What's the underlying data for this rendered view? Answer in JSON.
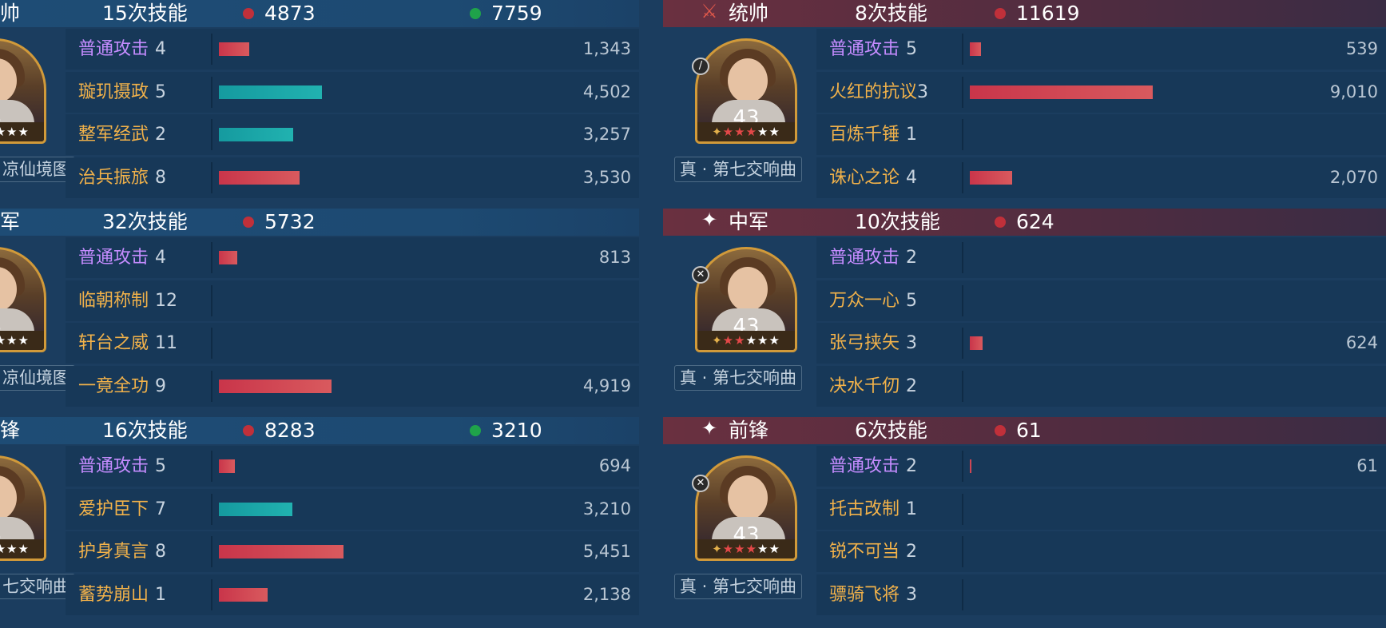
{
  "colors": {
    "red_bar": "#c9354a",
    "teal_bar": "#159a9f",
    "dot_red": "#c0303a",
    "dot_green": "#1fa34a"
  },
  "left": {
    "blocks": [
      {
        "role": "帅",
        "skill_count": "15次技能",
        "damage": "4873",
        "heal": "7759",
        "portrait": {
          "level": "3",
          "stars_on": 0,
          "stars_total": 5
        },
        "tag": "凉仙境图",
        "rows": [
          {
            "skill": "普通攻击",
            "count": "4",
            "bar": "red",
            "value": "1,343",
            "raw": 1343
          },
          {
            "skill": "璇玑摄政",
            "count": "5",
            "bar": "teal",
            "value": "4,502",
            "raw": 4502
          },
          {
            "skill": "整军经武",
            "count": "2",
            "bar": "teal",
            "value": "3,257",
            "raw": 3257
          },
          {
            "skill": "治兵振旅",
            "count": "8",
            "bar": "red",
            "value": "3,530",
            "raw": 3530
          }
        ]
      },
      {
        "role": "军",
        "skill_count": "32次技能",
        "damage": "5732",
        "heal": "",
        "portrait": {
          "level": "3",
          "stars_on": 0,
          "stars_total": 5
        },
        "tag": "凉仙境图",
        "rows": [
          {
            "skill": "普通攻击",
            "count": "4",
            "bar": "red",
            "value": "813",
            "raw": 813
          },
          {
            "skill": "临朝称制",
            "count": "12",
            "bar": "",
            "value": "",
            "raw": 0
          },
          {
            "skill": "轩台之威",
            "count": "11",
            "bar": "",
            "value": "",
            "raw": 0
          },
          {
            "skill": "一竟全功",
            "count": "9",
            "bar": "red",
            "value": "4,919",
            "raw": 4919
          }
        ]
      },
      {
        "role": "锋",
        "skill_count": "16次技能",
        "damage": "8283",
        "heal": "3210",
        "portrait": {
          "level": "3",
          "stars_on": 0,
          "stars_total": 5
        },
        "tag": "七交响曲",
        "rows": [
          {
            "skill": "普通攻击",
            "count": "5",
            "bar": "red",
            "value": "694",
            "raw": 694
          },
          {
            "skill": "爱护臣下",
            "count": "7",
            "bar": "teal",
            "value": "3,210",
            "raw": 3210
          },
          {
            "skill": "护身真言",
            "count": "8",
            "bar": "red",
            "value": "5,451",
            "raw": 5451
          },
          {
            "skill": "蓄势崩山",
            "count": "1",
            "bar": "red",
            "value": "2,138",
            "raw": 2138
          }
        ]
      }
    ]
  },
  "right": {
    "blocks": [
      {
        "role": "统帅",
        "role_icon": "sword-flag-icon",
        "skill_count": "8次技能",
        "damage": "11619",
        "heal": "",
        "portrait": {
          "level": "43",
          "stars_on": 3,
          "stars_total": 5
        },
        "badge": "/",
        "tag": "真 · 第七交响曲",
        "rows": [
          {
            "skill": "普通攻击",
            "count": "5",
            "bar": "red",
            "value": "539",
            "raw": 539
          },
          {
            "skill": "火红的抗议",
            "count": "3",
            "bar": "red",
            "value": "9,010",
            "raw": 9010
          },
          {
            "skill": "百炼千锤",
            "count": "1",
            "bar": "",
            "value": "",
            "raw": 0
          },
          {
            "skill": "诛心之论",
            "count": "4",
            "bar": "red",
            "value": "2,070",
            "raw": 2070
          }
        ]
      },
      {
        "role": "中军",
        "role_icon": "sparkle-icon",
        "skill_count": "10次技能",
        "damage": "624",
        "heal": "",
        "portrait": {
          "level": "43",
          "stars_on": 2,
          "stars_total": 5
        },
        "badge": "✕",
        "tag": "真 · 第七交响曲",
        "rows": [
          {
            "skill": "普通攻击",
            "count": "2",
            "bar": "",
            "value": "",
            "raw": 0
          },
          {
            "skill": "万众一心",
            "count": "5",
            "bar": "",
            "value": "",
            "raw": 0
          },
          {
            "skill": "张弓挟矢",
            "count": "3",
            "bar": "red",
            "value": "624",
            "raw": 624
          },
          {
            "skill": "决水千仞",
            "count": "2",
            "bar": "",
            "value": "",
            "raw": 0
          }
        ]
      },
      {
        "role": "前锋",
        "role_icon": "sparkle-icon",
        "skill_count": "6次技能",
        "damage": "61",
        "heal": "",
        "portrait": {
          "level": "43",
          "stars_on": 3,
          "stars_total": 5
        },
        "badge": "✕",
        "tag": "真 · 第七交响曲",
        "rows": [
          {
            "skill": "普通攻击",
            "count": "2",
            "bar": "red",
            "value": "61",
            "raw": 61
          },
          {
            "skill": "托古改制",
            "count": "1",
            "bar": "",
            "value": "",
            "raw": 0
          },
          {
            "skill": "锐不可当",
            "count": "2",
            "bar": "",
            "value": "",
            "raw": 0
          },
          {
            "skill": "骠骑飞将",
            "count": "3",
            "bar": "",
            "value": "",
            "raw": 0
          }
        ]
      }
    ]
  }
}
